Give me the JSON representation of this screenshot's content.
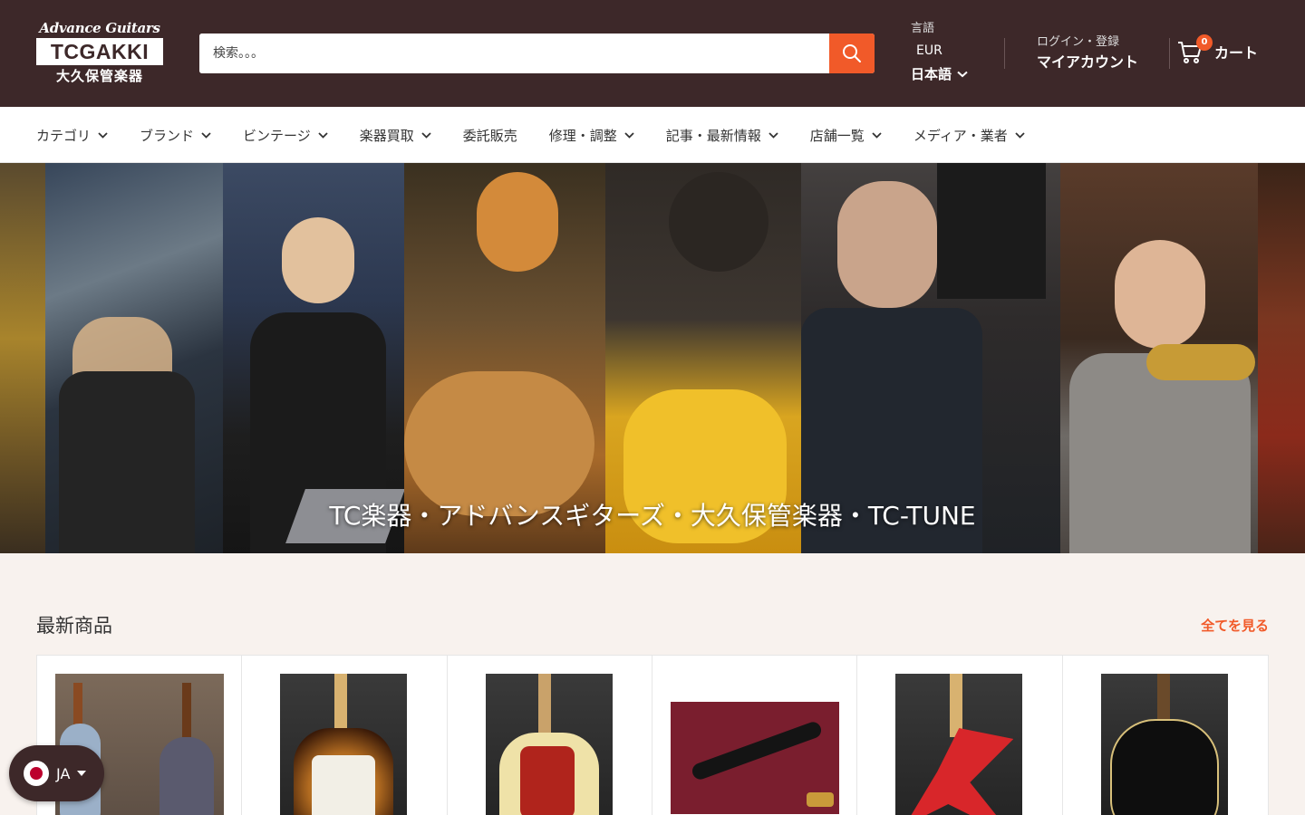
{
  "header": {
    "logo": {
      "line1": "Advance Guitars",
      "line2": "TCGAKKI",
      "line3": "大久保管楽器"
    },
    "search": {
      "placeholder": "検索。。。"
    },
    "language": {
      "label": "言語",
      "currency": "EUR",
      "selected": "日本語"
    },
    "account": {
      "login": "ログイン・登録",
      "my_account": "マイアカウント"
    },
    "cart": {
      "count": "0",
      "label": "カート"
    }
  },
  "nav": {
    "items": [
      {
        "label": "カテゴリ",
        "dropdown": true
      },
      {
        "label": "ブランド",
        "dropdown": true
      },
      {
        "label": "ビンテージ",
        "dropdown": true
      },
      {
        "label": "楽器買取",
        "dropdown": true
      },
      {
        "label": "委託販売",
        "dropdown": false
      },
      {
        "label": "修理・調整",
        "dropdown": true
      },
      {
        "label": "記事・最新情報",
        "dropdown": true
      },
      {
        "label": "店舗一覧",
        "dropdown": true
      },
      {
        "label": "メディア・業者",
        "dropdown": true
      }
    ]
  },
  "hero": {
    "title": "TC楽器・アドバンスギターズ・大久保管楽器・TC-TUNE"
  },
  "products": {
    "title": "最新商品",
    "view_all": "全てを見る",
    "items": [
      {
        "thumb": "mandolin-pair"
      },
      {
        "thumb": "sunburst-stratocaster"
      },
      {
        "thumb": "cream-jazz-bass"
      },
      {
        "thumb": "clarinet"
      },
      {
        "thumb": "red-star-bass"
      },
      {
        "thumb": "black-semi-hollow"
      }
    ]
  },
  "language_widget": {
    "code": "JA"
  },
  "colors": {
    "header_bg": "#3d2829",
    "accent": "#f15a29",
    "page_bg": "#f8f2ee"
  }
}
